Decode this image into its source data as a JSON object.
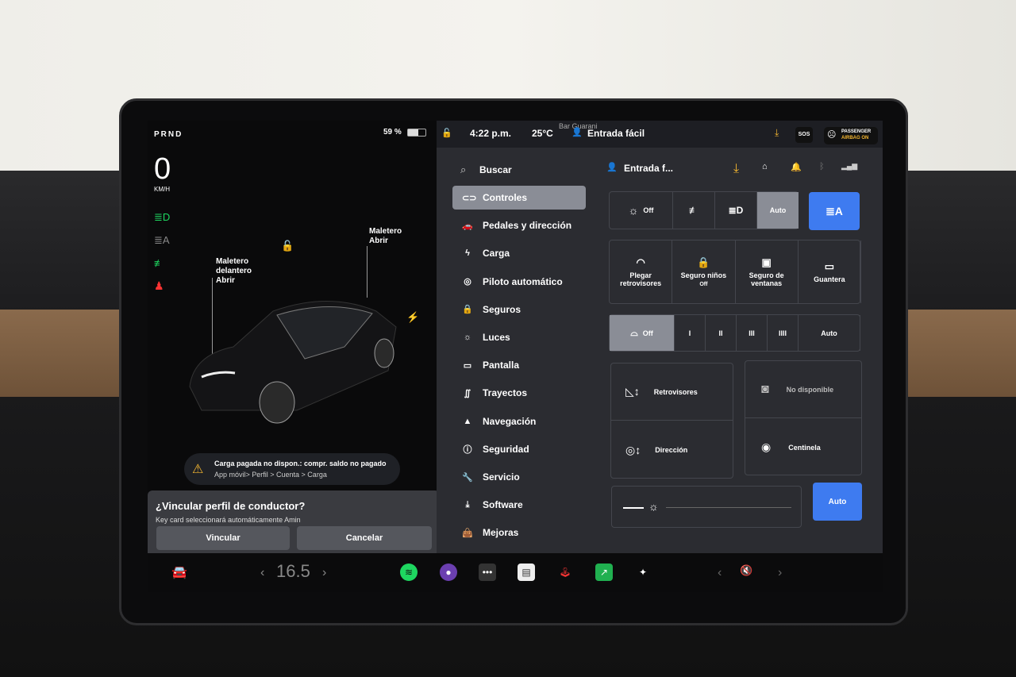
{
  "status": {
    "gear": "PRND",
    "speed": "0",
    "speed_unit": "KM/H",
    "battery": "59 %",
    "time": "4:22 p.m.",
    "temp": "25°C",
    "map_label": "Bar Guarani",
    "profile": "Entrada fácil",
    "sos": "SOS",
    "airbag_line1": "PASSENGER",
    "airbag_line2": "AIRBAG ON"
  },
  "car": {
    "frunk_label": "Maletero delantero",
    "frunk_action": "Abrir",
    "trunk_label": "Maletero",
    "trunk_action": "Abrir"
  },
  "alert": {
    "title": "Carga pagada no dispon.: compr. saldo no pagado",
    "path": "App móvil> Perfil > Cuenta > Carga"
  },
  "dialog": {
    "title": "¿Vincular perfil de conductor?",
    "text": "Key card seleccionará automáticamente Amin",
    "confirm": "Vincular",
    "cancel": "Cancelar"
  },
  "header": {
    "search": "Buscar",
    "profile": "Entrada f..."
  },
  "menu": [
    {
      "label": "Controles",
      "icon": "toggle-icon"
    },
    {
      "label": "Pedales y dirección",
      "icon": "car-icon"
    },
    {
      "label": "Carga",
      "icon": "bolt-icon"
    },
    {
      "label": "Piloto automático",
      "icon": "steering-wheel-icon"
    },
    {
      "label": "Seguros",
      "icon": "lock-icon"
    },
    {
      "label": "Luces",
      "icon": "sun-icon"
    },
    {
      "label": "Pantalla",
      "icon": "display-icon"
    },
    {
      "label": "Trayectos",
      "icon": "trips-icon"
    },
    {
      "label": "Navegación",
      "icon": "navigation-icon"
    },
    {
      "label": "Seguridad",
      "icon": "info-icon"
    },
    {
      "label": "Servicio",
      "icon": "wrench-icon"
    },
    {
      "label": "Software",
      "icon": "download-icon"
    },
    {
      "label": "Mejoras",
      "icon": "bag-icon"
    }
  ],
  "lights": {
    "off": "Off",
    "auto": "Auto"
  },
  "quick": [
    {
      "label": "Plegar retrovisores"
    },
    {
      "label": "Seguro niños",
      "sub": "Off"
    },
    {
      "label": "Seguro de ventanas"
    },
    {
      "label": "Guantera"
    }
  ],
  "wipers": [
    "Off",
    "I",
    "II",
    "III",
    "IIII",
    "Auto"
  ],
  "adjust": {
    "mirrors": "Retrovisores",
    "steering": "Dirección",
    "unavailable": "No disponible",
    "sentry": "Centinela"
  },
  "brightness": {
    "auto": "Auto"
  },
  "bottom": {
    "temp": "16.5"
  },
  "colors": {
    "accent": "#3e7bf0",
    "active": "#8a8d96",
    "warning": "#f5b731",
    "spotify": "#1ed760"
  }
}
